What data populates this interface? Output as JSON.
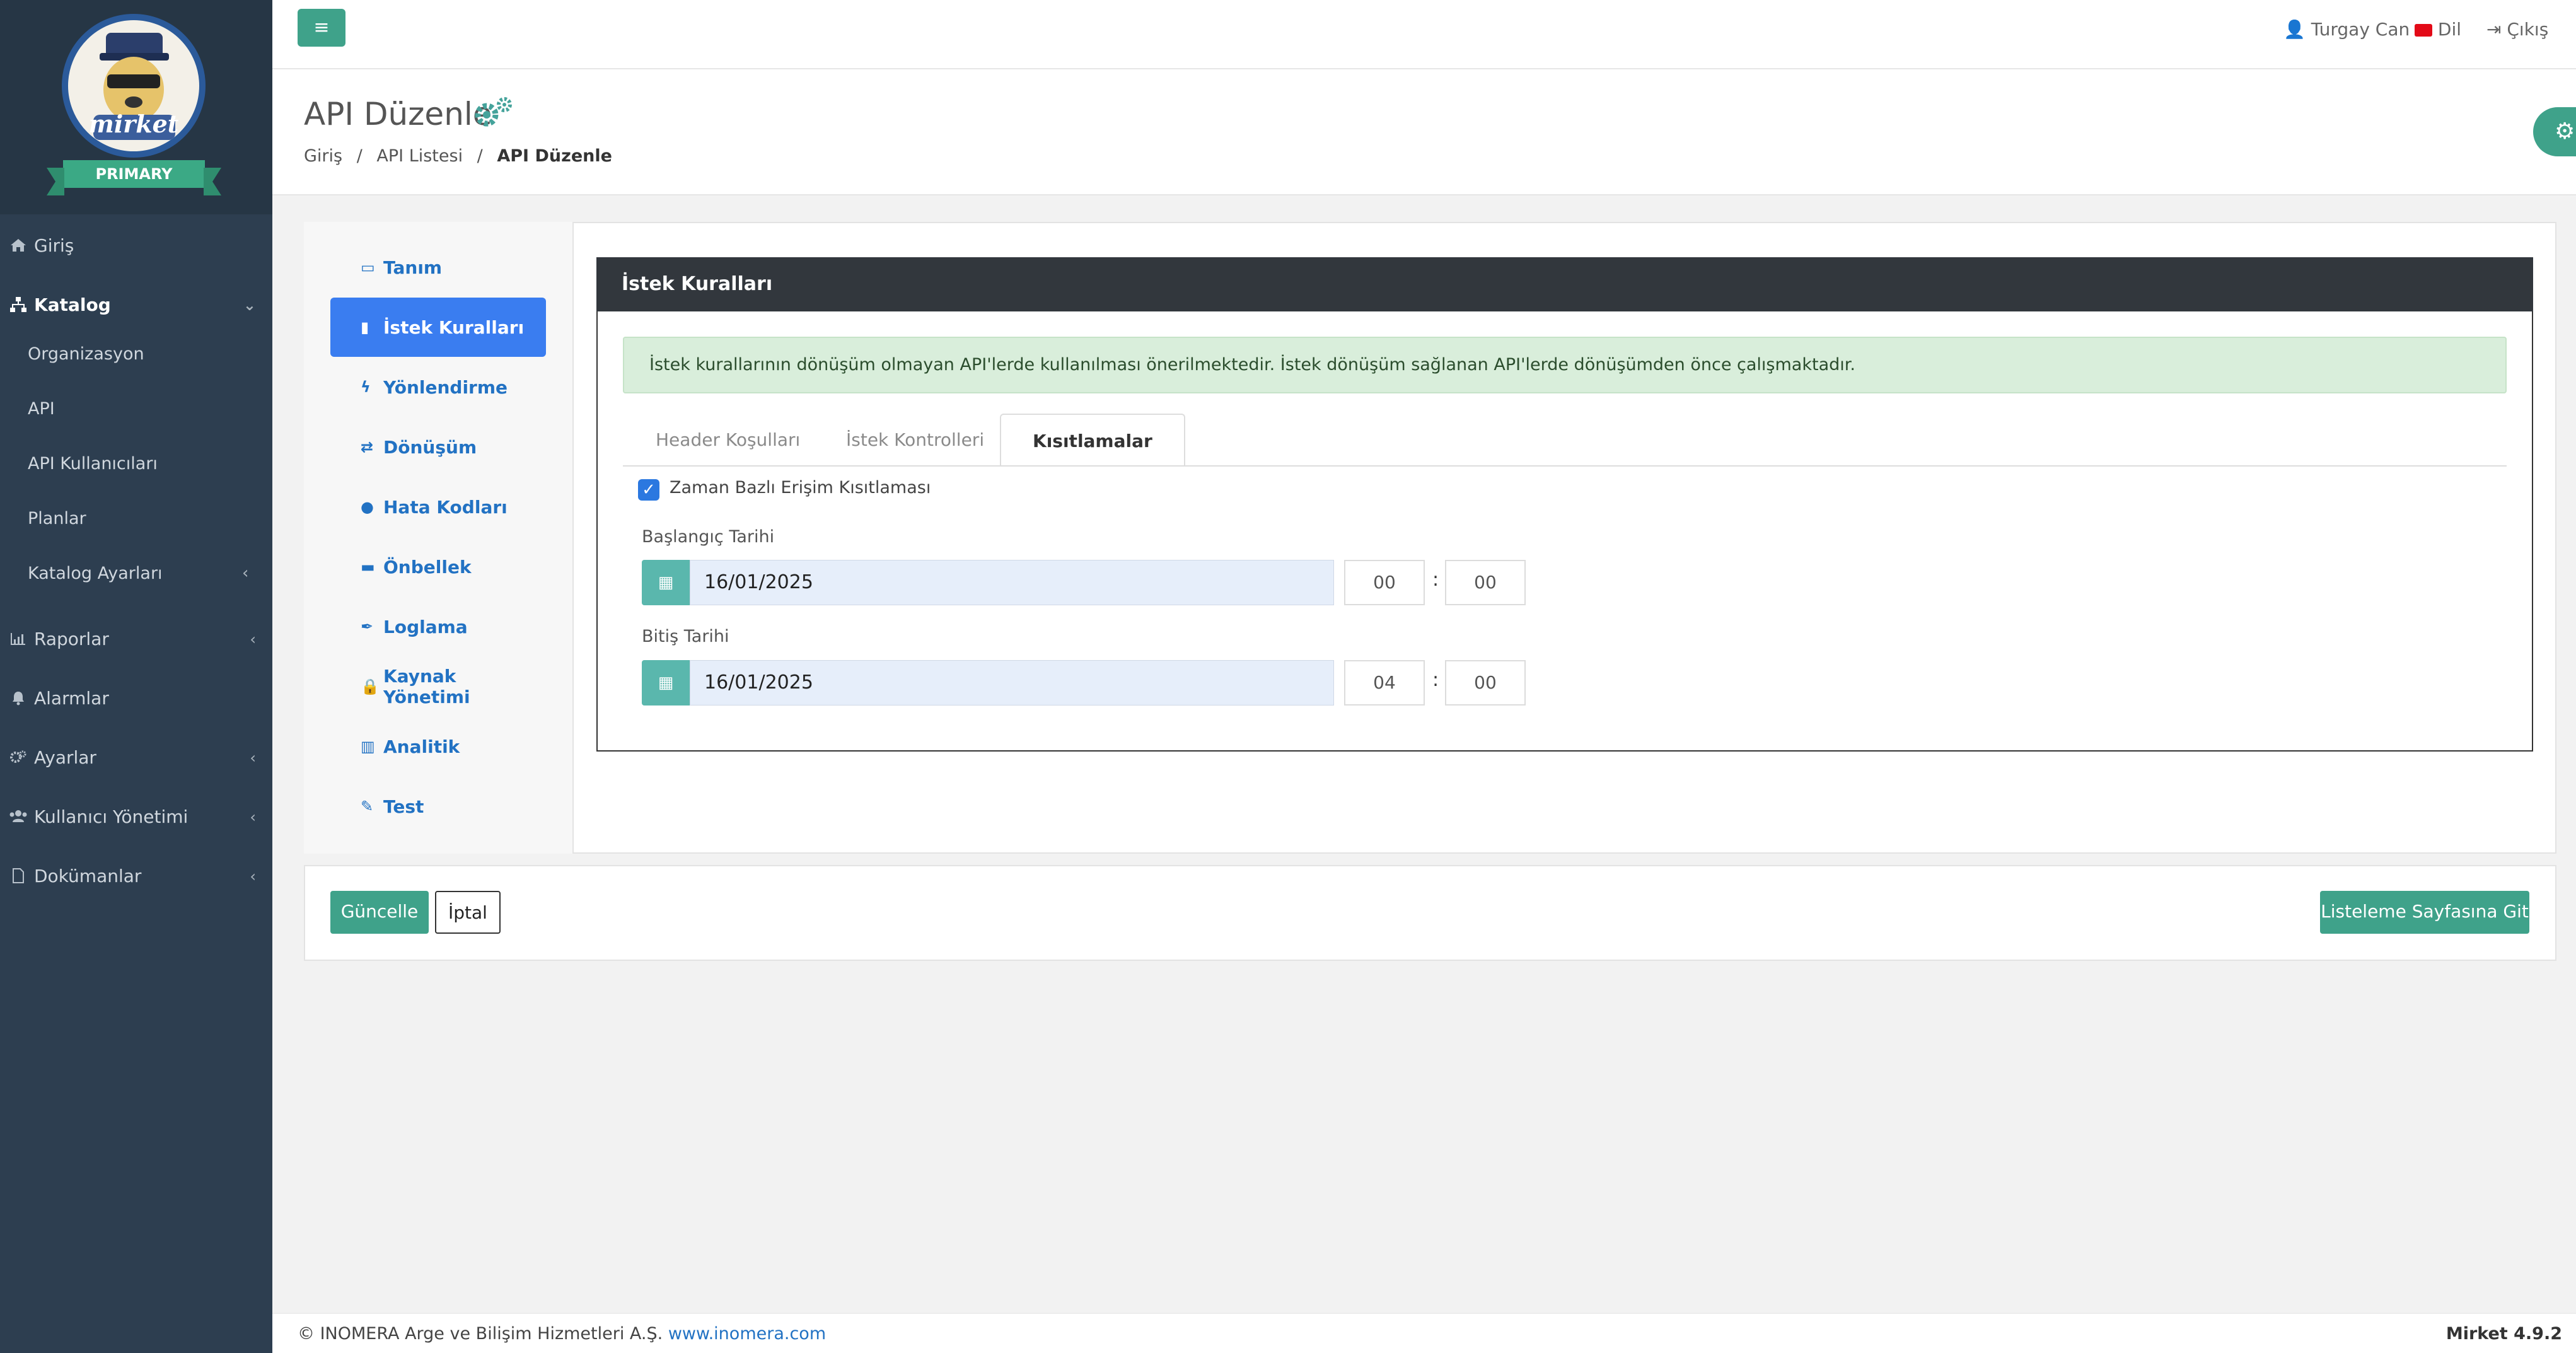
{
  "sidebar": {
    "brand_ribbon": "PRIMARY",
    "logo_text": "mirket",
    "items": [
      {
        "label": "Giriş",
        "icon": "home-icon"
      },
      {
        "label": "Katalog",
        "icon": "sitemap-icon"
      },
      {
        "label": "Raporlar",
        "icon": "chart-icon"
      },
      {
        "label": "Alarmlar",
        "icon": "bell-icon"
      },
      {
        "label": "Ayarlar",
        "icon": "gears-icon"
      },
      {
        "label": "Kullanıcı Yönetimi",
        "icon": "users-icon"
      },
      {
        "label": "Dokümanlar",
        "icon": "file-icon"
      }
    ],
    "katalog_sub": [
      "Organizasyon",
      "API",
      "API Kullanıcıları",
      "Planlar",
      "Katalog Ayarları"
    ]
  },
  "header": {
    "user_name": "Turgay Can",
    "language": "Dil",
    "logout": "Çıkış"
  },
  "page": {
    "title": "API Düzenle",
    "breadcrumb": [
      "Giriş",
      "API Listesi",
      "API Düzenle"
    ]
  },
  "left_menu": {
    "items": [
      {
        "label": "Tanım",
        "icon": "id-card-icon"
      },
      {
        "label": "İstek Kuralları",
        "icon": "trash-icon"
      },
      {
        "label": "Yönlendirme",
        "icon": "bolt-icon"
      },
      {
        "label": "Dönüşüm",
        "icon": "exchange-icon"
      },
      {
        "label": "Hata Kodları",
        "icon": "exclamation-icon"
      },
      {
        "label": "Önbellek",
        "icon": "memory-icon"
      },
      {
        "label": "Loglama",
        "icon": "feather-icon"
      },
      {
        "label": "Kaynak Yönetimi",
        "icon": "lock-icon"
      },
      {
        "label": "Analitik",
        "icon": "chart-line-icon"
      },
      {
        "label": "Test",
        "icon": "pen-icon"
      }
    ],
    "active_index": 1
  },
  "panel": {
    "title": "İstek Kuralları",
    "alert": "İstek kurallarının dönüşüm olmayan API'lerde kullanılması önerilmektedir. İstek dönüşüm sağlanan API'lerde dönüşümden önce çalışmaktadır.",
    "tabs": [
      "Header Koşulları",
      "İstek Kontrolleri",
      "Kısıtlamalar"
    ],
    "active_tab": 2,
    "checkbox_label": "Zaman Bazlı Erişim Kısıtlaması",
    "checkbox_checked": true,
    "start": {
      "label": "Başlangıç Tarihi",
      "date": "16/01/2025",
      "hour": "00",
      "minute": "00"
    },
    "end": {
      "label": "Bitiş Tarihi",
      "date": "16/01/2025",
      "hour": "04",
      "minute": "00"
    }
  },
  "actions": {
    "update": "Güncelle",
    "cancel": "İptal",
    "go_list": "Listeleme Sayfasına Git"
  },
  "footer": {
    "copyright": "© INOMERA Arge ve Bilişim Hizmetleri A.Ş.",
    "link": "www.inomera.com",
    "version": "Mirket 4.9.2"
  },
  "colors": {
    "sidebar": "#2d3e50",
    "accent_green": "#3fa28a",
    "active_blue": "#3a7df0",
    "panel_header": "#32373d"
  }
}
